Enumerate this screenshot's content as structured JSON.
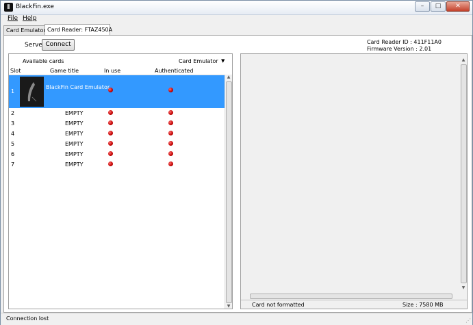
{
  "window": {
    "title": "BlackFin.exe",
    "minimize": "–",
    "maximize": "□",
    "close": "✕"
  },
  "menu": [
    {
      "label": "File"
    },
    {
      "label": "Help"
    }
  ],
  "tabs": [
    {
      "label": "Card Emulator"
    },
    {
      "label": "Card Reader: FTAZ450A"
    }
  ],
  "server": {
    "label": "Server:",
    "connect_label": "Connect"
  },
  "reader_info": {
    "id": "Card Reader ID : 411F11A0",
    "firmware": "Firmware Version : 2.01"
  },
  "cards": {
    "label": "Available cards",
    "mode": "Card Emulator",
    "columns": [
      "Slot",
      "Game title",
      "In use",
      "Authenticated"
    ],
    "rows": [
      {
        "slot": "1",
        "title": "BlackFin Card Emulator"
      },
      {
        "slot": "2",
        "title": "EMPTY"
      },
      {
        "slot": "3",
        "title": "EMPTY"
      },
      {
        "slot": "4",
        "title": "EMPTY"
      },
      {
        "slot": "5",
        "title": "EMPTY"
      },
      {
        "slot": "6",
        "title": "EMPTY"
      },
      {
        "slot": "7",
        "title": "EMPTY"
      }
    ]
  },
  "right_panel": {
    "status": "Card not formatted",
    "size": "Size : 7580 MB"
  },
  "statusbar": {
    "text": "Connection lost"
  },
  "colors": {
    "selection": "#3399ff",
    "status_dot": "#cc0000"
  },
  "icons": {
    "status": "red-dot",
    "thumbnail": "blackfin-logo"
  }
}
